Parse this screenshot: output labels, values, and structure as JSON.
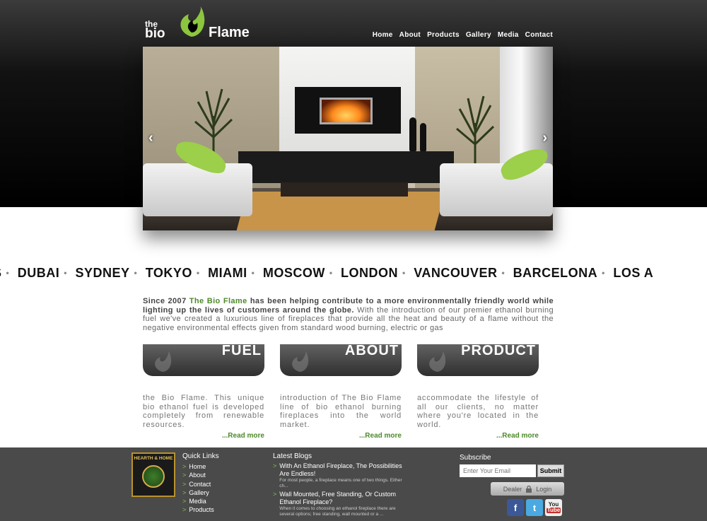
{
  "brand": {
    "the": "the",
    "bio": "bio",
    "flame": "Flame",
    "name": "The Bio Flame",
    "accent": "#4d8a2a",
    "leaf_green": "#7fc24a"
  },
  "nav": [
    "Home",
    "About",
    "Products",
    "Gallery",
    "Media",
    "Contact"
  ],
  "hero": {
    "prev_icon": "chevron-left-icon",
    "next_icon": "chevron-right-icon",
    "prev": "‹",
    "next": "›"
  },
  "cities": [
    "S",
    "DUBAI",
    "SYDNEY",
    "TOKYO",
    "MIAMI",
    "MOSCOW",
    "LONDON",
    "VANCOUVER",
    "BARCELONA",
    "LOS A"
  ],
  "intro": {
    "since": "Since 2007",
    "brand": "The Bio Flame",
    "bold_rest": "has been helping contribute to a more environmentally friendly world while lighting up the lives of customers around the globe.",
    "rest": "With the introduction of our premier ethanol burning fuel we've created a luxurious line of fireplaces that provide all the heat and beauty of a flame without the negative environmental effects given from standard wood burning, electric or gas"
  },
  "cards": [
    {
      "title": "FUEL",
      "text": "the Bio Flame. This unique bio ethanol fuel is developed completely from renewable resources.",
      "more": "...Read more"
    },
    {
      "title": "ABOUT",
      "text": "introduction of The Bio Flame line of bio ethanol burning fireplaces into the world market.",
      "more": "...Read more"
    },
    {
      "title": "PRODUCT",
      "text": "accommodate the lifestyle of all our clients, no matter where you're located in the world.",
      "more": "...Read more"
    }
  ],
  "footer": {
    "badge_top": "HEARTH & HOME",
    "quick_links_title": "Quick Links",
    "quick_links": [
      "Home",
      "About",
      "Contact",
      "Gallery",
      "Media",
      "Products"
    ],
    "blogs_title": "Latest Blogs",
    "blogs": [
      {
        "title": "With An Ethanol Fireplace, The Possibilities Are Endless!",
        "excerpt": "For most people, a fireplace means one of two things. Either ch..."
      },
      {
        "title": "Wall Mounted, Free Standing, Or Custom Ethanol Fireplace?",
        "excerpt": "When it comes to choosing an ethanol fireplace there are several options; free standing, wall mounted or a ..."
      }
    ],
    "subscribe_title": "Subscribe",
    "email_placeholder": "Enter Your Email",
    "submit": "Submit",
    "dealer": "Dealer",
    "login": "Login",
    "social": {
      "facebook": "f",
      "twitter": "t",
      "youtube_1": "You",
      "youtube_2": "Tube"
    }
  }
}
